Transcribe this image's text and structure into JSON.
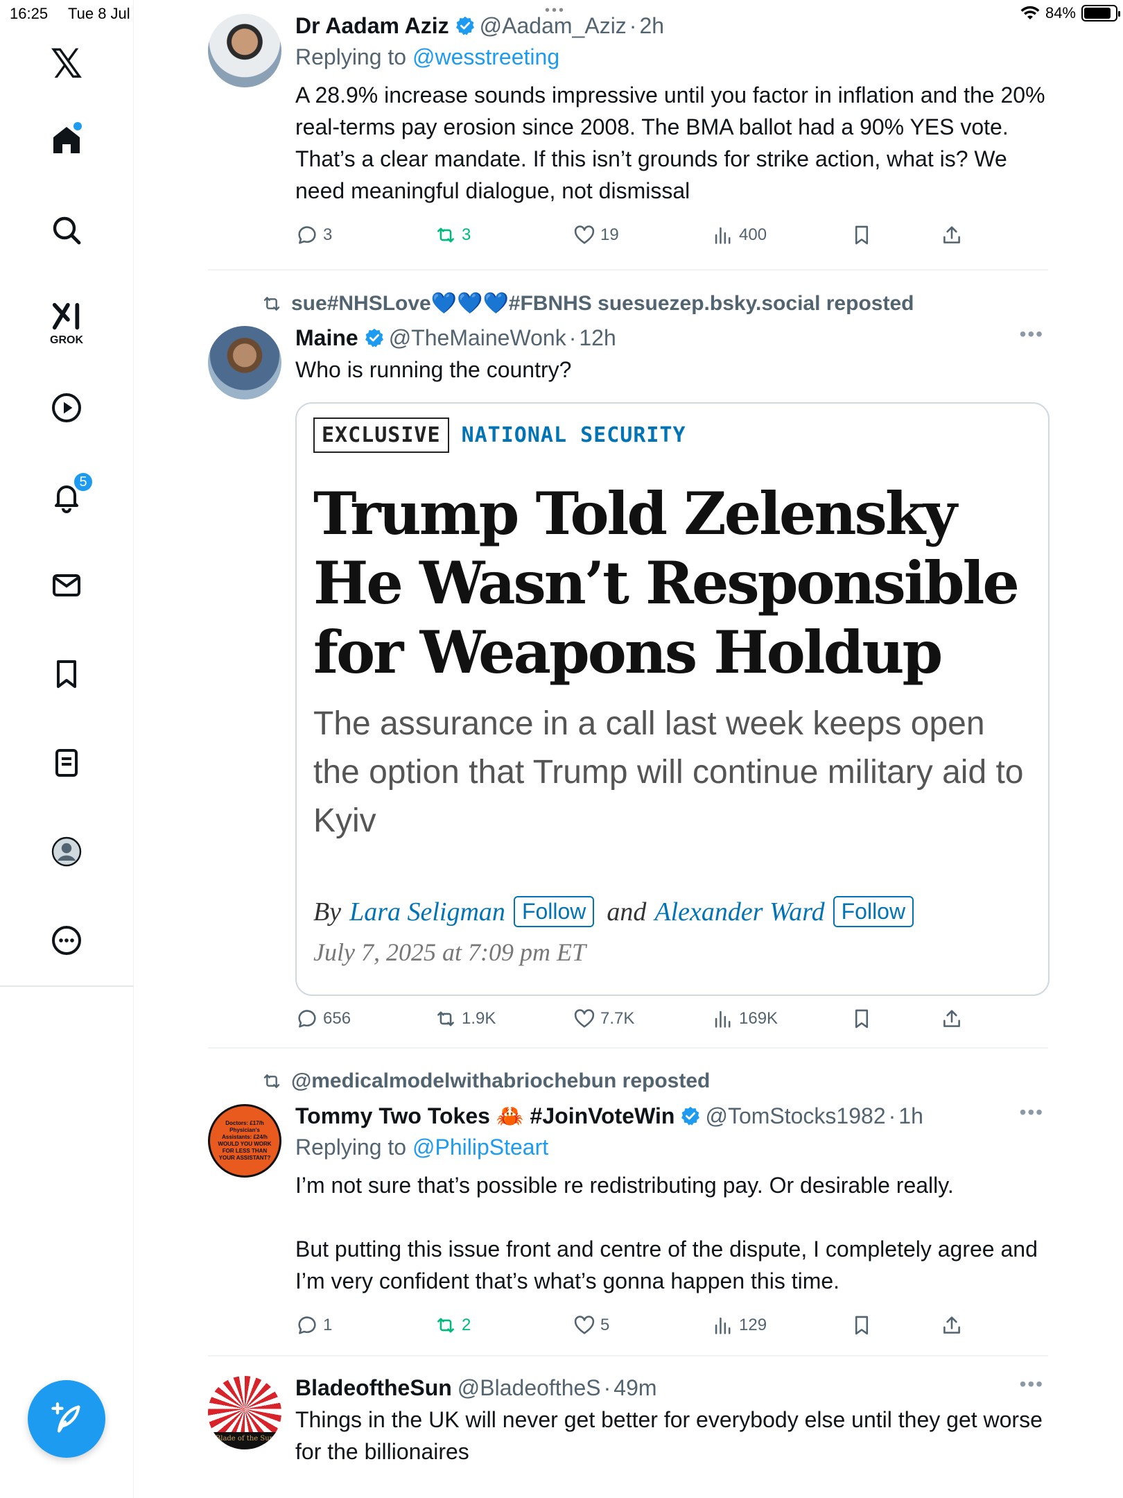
{
  "status_bar": {
    "time": "16:25",
    "date": "Tue 8 Jul",
    "battery": "84%",
    "center_dots": "•••"
  },
  "sidebar": {
    "grok_label": "GROK",
    "notification_count": "5",
    "items": [
      "x-logo",
      "home-icon",
      "search-icon",
      "grok-icon",
      "video-icon",
      "bell-icon",
      "mail-icon",
      "bookmark-icon",
      "lists-icon",
      "profile-icon",
      "more-icon"
    ]
  },
  "tweets": [
    {
      "name": "Dr Aadam Aziz",
      "handle": "@Aadam_Aziz",
      "time": "2h",
      "replying_prefix": "Replying to",
      "replying_to": "@wesstreeting",
      "text": "A 28.9% increase sounds impressive until you factor in inflation and the 20% real-terms pay erosion since 2008. The BMA ballot had a 90% YES vote. That’s a clear mandate. If this isn’t grounds for strike action, what is? We need meaningful dialogue, not dismissal",
      "replies": "3",
      "reposts": "3",
      "likes": "19",
      "views": "400"
    },
    {
      "repost_by": "sue#NHSLove💙💙💙#FBNHS suesuezep.bsky.social reposted",
      "name": "Maine",
      "handle": "@TheMaineWonk",
      "time": "12h",
      "text": "Who is running the country?",
      "article": {
        "tag_exclusive": "EXCLUSIVE",
        "tag_section": "NATIONAL SECURITY",
        "headline": "Trump Told Zelensky He Wasn’t Responsible for Weapons Holdup",
        "dek": "The assurance in a call last week keeps open the option that Trump will continue military aid to Kyiv",
        "by": "By",
        "author1": "Lara Seligman",
        "and": "and",
        "author2": "Alexander Ward",
        "follow_label": "Follow",
        "dateline": "July 7, 2025 at 7:09 pm ET"
      },
      "replies": "656",
      "reposts": "1.9K",
      "likes": "7.7K",
      "views": "169K"
    },
    {
      "repost_by": "@medicalmodelwithabriochebun reposted",
      "name": "Tommy Two Tokes 🦀 #JoinVoteWin",
      "handle": "@TomStocks1982",
      "time": "1h",
      "replying_prefix": "Replying to",
      "replying_to": "@PhilipSteart",
      "avatar_text": "Doctors: £17/h Physician's Assistants: £24/h WOULD YOU WORK FOR LESS THAN YOUR ASSISTANT?",
      "text": "I’m not sure that’s possible re redistributing pay. Or desirable really.\n\nBut putting this issue front and centre of the dispute, I completely agree and I’m very confident that’s what’s gonna happen this time.",
      "replies": "1",
      "reposts": "2",
      "likes": "5",
      "views": "129"
    },
    {
      "name": "BladeoftheSun",
      "handle": "@BladeoftheS",
      "time": "49m",
      "avatar_text": "Blade of the Sun",
      "text": "Things in the UK will never get better for everybody else until they get worse for the billionaires"
    }
  ],
  "colors": {
    "accent": "#1d9bf0",
    "repost_green": "#00ba7c",
    "secondary_text": "#536471",
    "article_blue": "#0274b6"
  }
}
